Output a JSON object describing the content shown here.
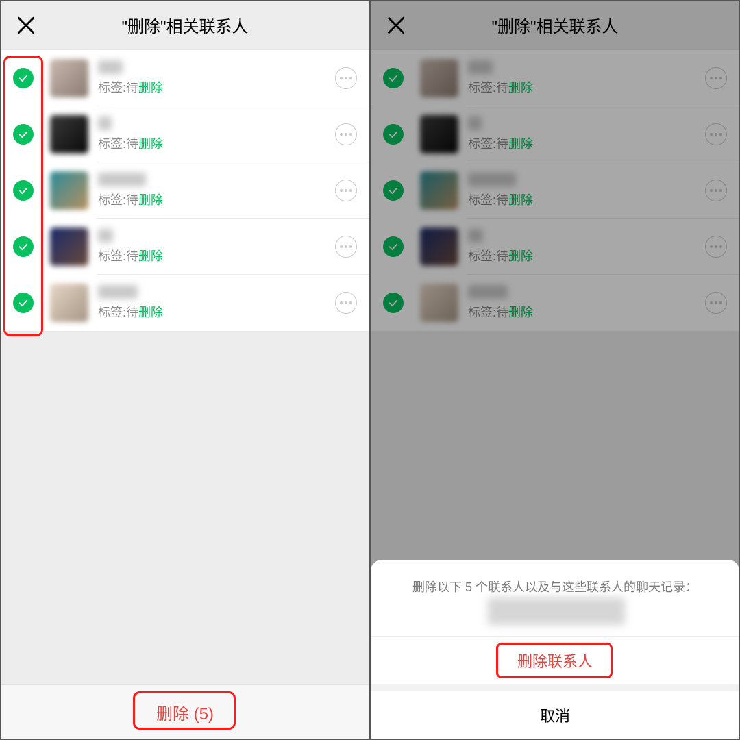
{
  "left": {
    "title": "\"删除\"相关联系人",
    "contacts": [
      {
        "nameWidth": 36,
        "tagPrefix": "标签:待",
        "tagValue": "删除"
      },
      {
        "nameWidth": 20,
        "tagPrefix": "标签:待",
        "tagValue": "删除"
      },
      {
        "nameWidth": 70,
        "tagPrefix": "标签:待",
        "tagValue": "删除"
      },
      {
        "nameWidth": 22,
        "tagPrefix": "标签:待",
        "tagValue": "删除"
      },
      {
        "nameWidth": 58,
        "tagPrefix": "标签:待",
        "tagValue": "删除"
      }
    ],
    "deleteLabel": "删除 (5)"
  },
  "right": {
    "title": "\"删除\"相关联系人",
    "contacts": [
      {
        "nameWidth": 36,
        "tagPrefix": "标签:待",
        "tagValue": "删除"
      },
      {
        "nameWidth": 20,
        "tagPrefix": "标签:待",
        "tagValue": "删除"
      },
      {
        "nameWidth": 70,
        "tagPrefix": "标签:待",
        "tagValue": "删除"
      },
      {
        "nameWidth": 22,
        "tagPrefix": "标签:待",
        "tagValue": "删除"
      },
      {
        "nameWidth": 58,
        "tagPrefix": "标签:待",
        "tagValue": "删除"
      }
    ],
    "sheet": {
      "message": "删除以下 5 个联系人以及与这些联系人的聊天记录：",
      "confirmLabel": "删除联系人",
      "cancelLabel": "取消"
    }
  }
}
